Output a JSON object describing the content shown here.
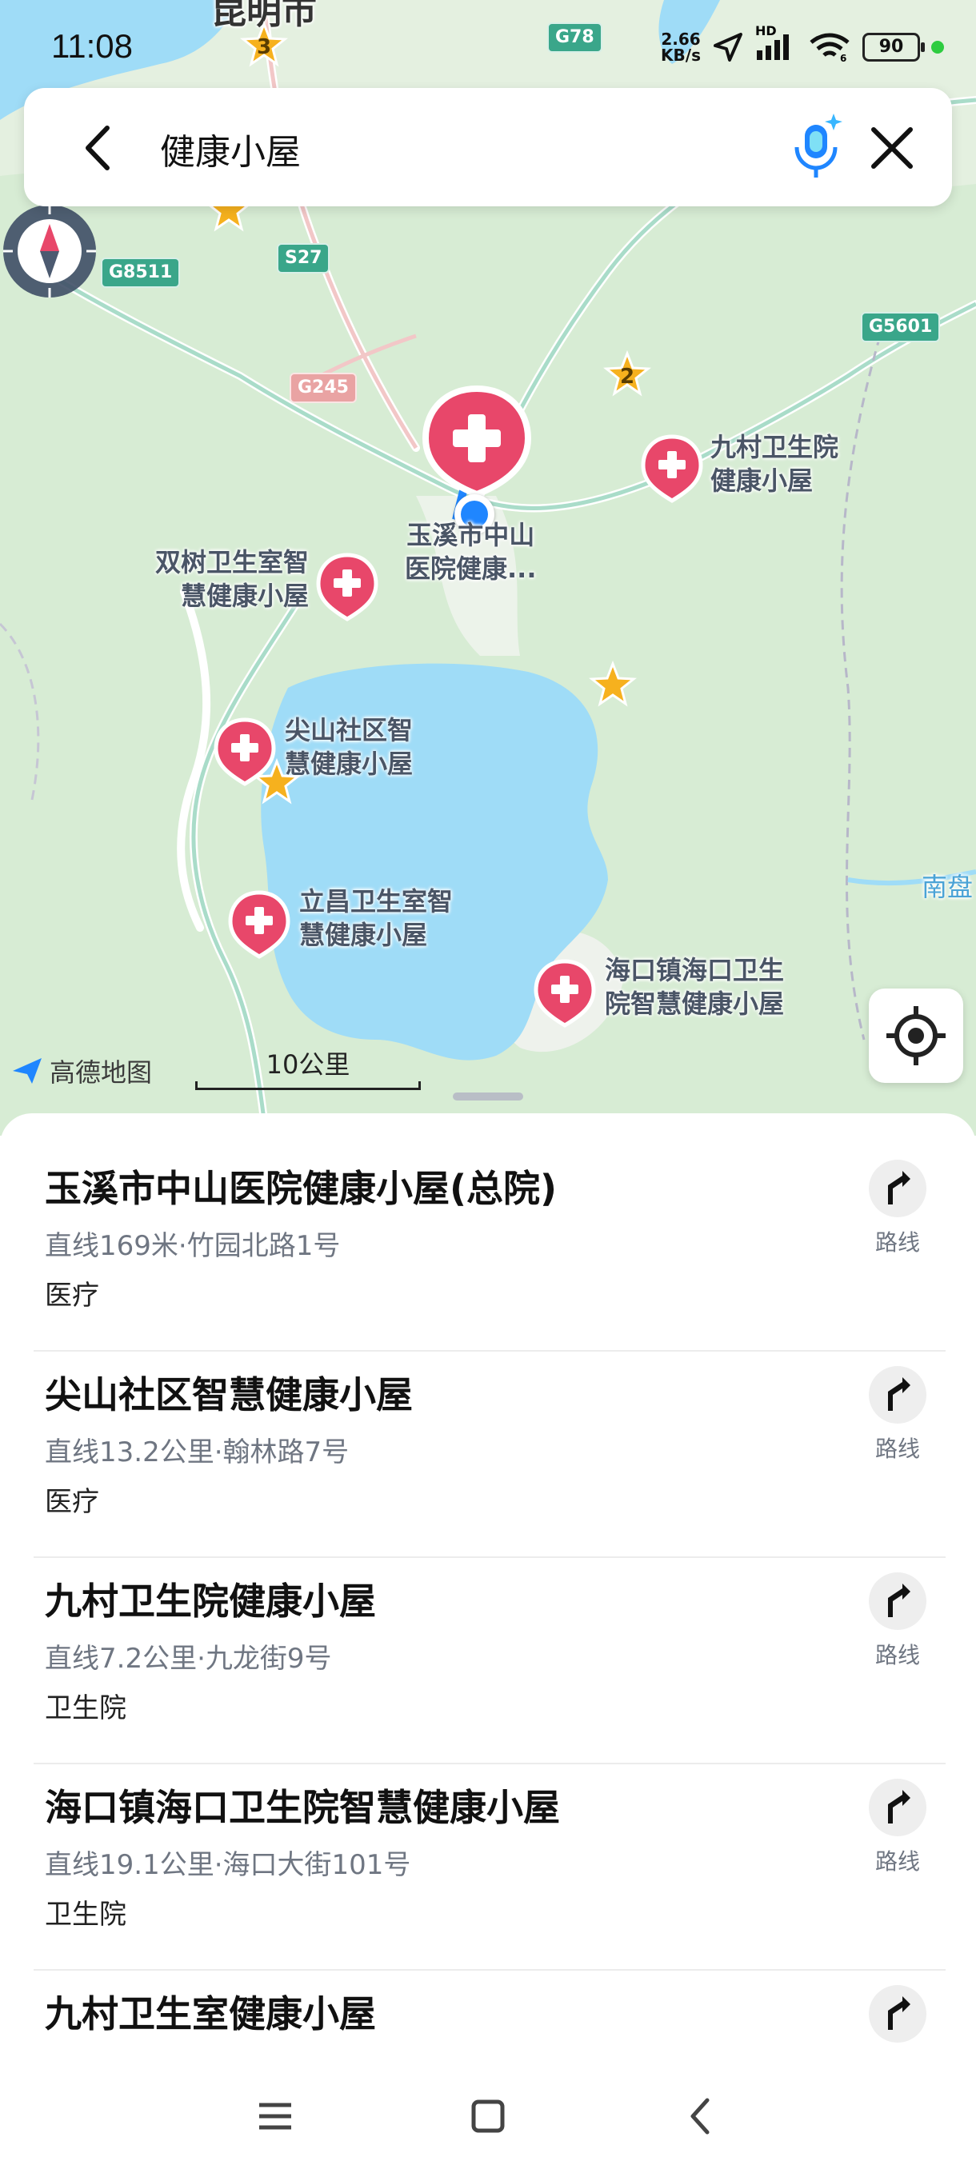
{
  "status_bar": {
    "time": "11:08",
    "net_speed_value": "2.66",
    "net_speed_unit": "KB/s",
    "hd_label": "HD",
    "battery": "90"
  },
  "search": {
    "query": "健康小屋"
  },
  "map": {
    "city_label": "昆明市",
    "road_shields": [
      "G78",
      "G8511",
      "S27",
      "G245",
      "G5601"
    ],
    "pins": [
      {
        "line1": "玉溪市中山",
        "line2": "医院健康..."
      },
      {
        "line1": "九村卫生院",
        "line2": "健康小屋"
      },
      {
        "line1": "双树卫生室智",
        "line2": "慧健康小屋"
      },
      {
        "line1": "尖山社区智",
        "line2": "慧健康小屋"
      },
      {
        "line1": "立昌卫生室智",
        "line2": "慧健康小屋"
      },
      {
        "line1": "海口镇海口卫生",
        "line2": "院智慧健康小屋"
      }
    ],
    "star_numbers": [
      "3",
      "2"
    ],
    "river_label": "南盘",
    "logo_text": "高德地图",
    "scale_label": "10公里"
  },
  "results": [
    {
      "title": "玉溪市中山医院健康小屋(总院)",
      "subtitle": "直线169米·竹园北路1号",
      "category": "医疗",
      "route_label": "路线"
    },
    {
      "title": "尖山社区智慧健康小屋",
      "subtitle": "直线13.2公里·翰林路7号",
      "category": "医疗",
      "route_label": "路线"
    },
    {
      "title": "九村卫生院健康小屋",
      "subtitle": "直线7.2公里·九龙街9号",
      "category": "卫生院",
      "route_label": "路线"
    },
    {
      "title": "海口镇海口卫生院智慧健康小屋",
      "subtitle": "直线19.1公里·海口大街101号",
      "category": "卫生院",
      "route_label": "路线"
    },
    {
      "title": "九村卫生室健康小屋",
      "subtitle": "",
      "category": "",
      "route_label": ""
    }
  ],
  "colors": {
    "pin_red": "#e8476a",
    "lake_blue": "#9fdcf7",
    "land_green": "#d6ecd3",
    "accent_blue": "#1f86ff"
  }
}
